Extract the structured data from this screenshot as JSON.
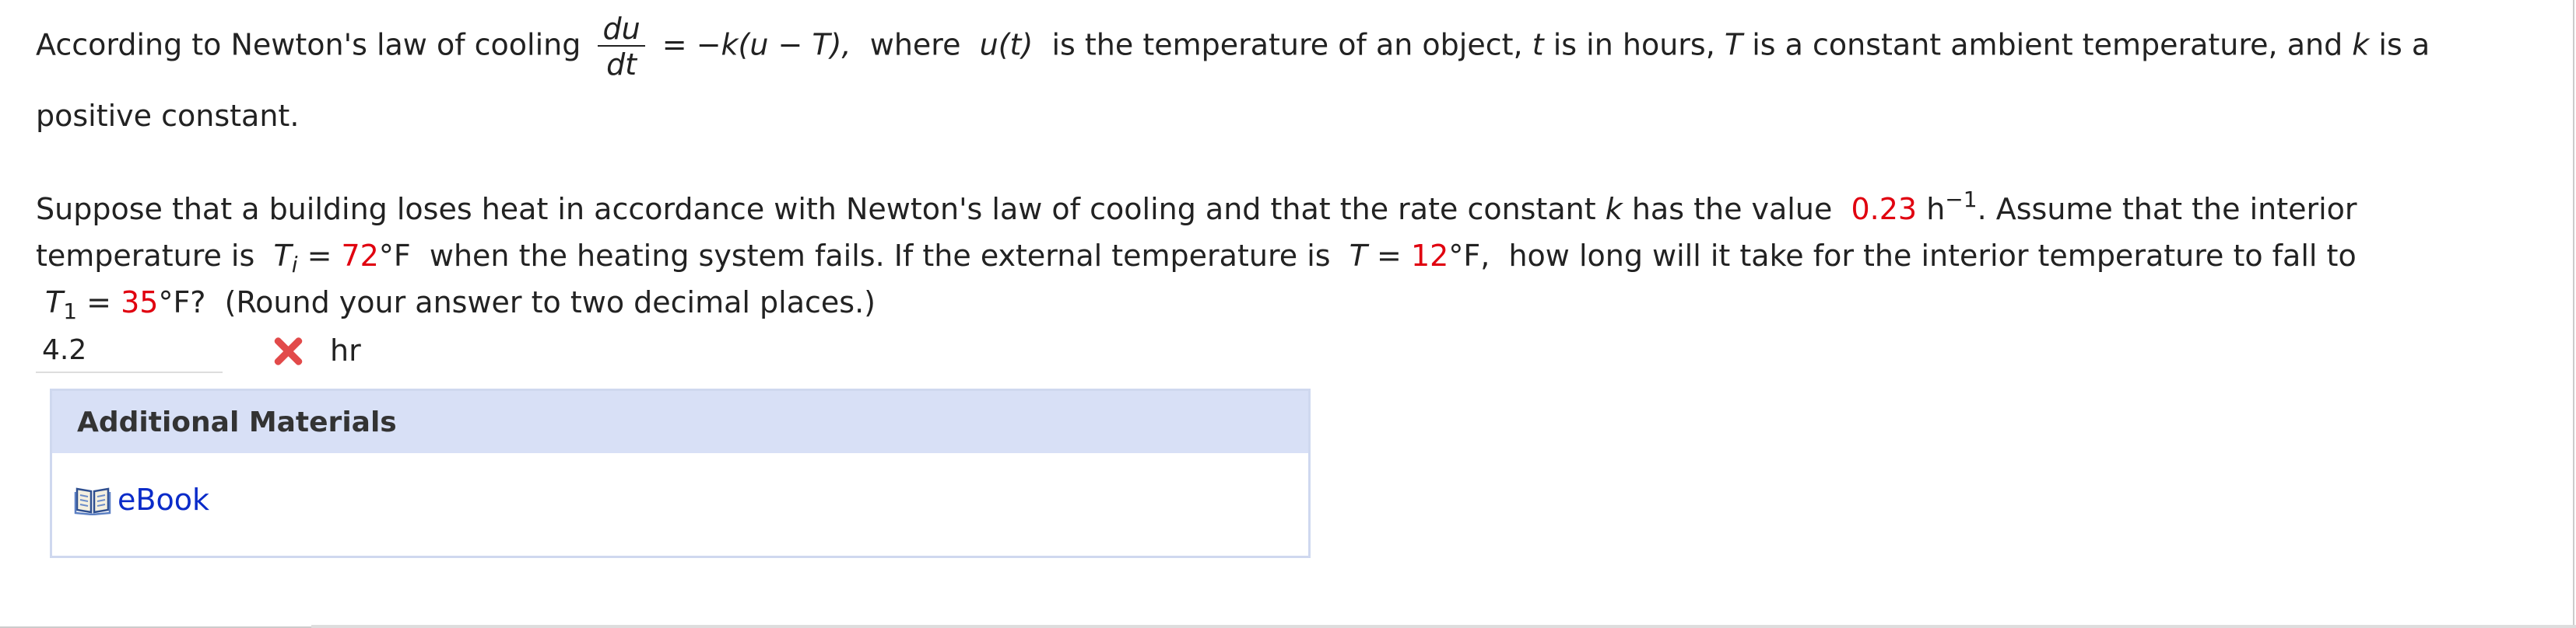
{
  "question": {
    "intro_prefix": "According to Newton's law of cooling",
    "fraction_num": "du",
    "fraction_den": "dt",
    "equation_rhs": "= −k(u − T),",
    "where_text": "where",
    "u_of_t": "u(t)",
    "intro_mid": "is the temperature of an object,",
    "t_var": "t",
    "hours_text": "is in hours,",
    "T_var": "T",
    "ambient_text": "is a constant ambient temperature, and",
    "k_var": "k",
    "intro_end": "is a",
    "intro_line2": "positive constant.",
    "p2_line1_start": "Suppose that a building loses heat in accordance with Newton's law of cooling and that the rate constant",
    "p2_k": "k",
    "p2_line1_mid": "has the value",
    "k_value": "0.23",
    "k_unit": "h",
    "k_unit_exp": "−1",
    "p2_line1_end": ". Assume that the interior",
    "p2_line2_start": "temperature is",
    "Ti_var": "T",
    "Ti_sub": "i",
    "eq_sign": "=",
    "Ti_value": "72",
    "deg_F": "°F",
    "p2_line2_mid": "when the heating system fails. If the external temperature is",
    "T_ext_var": "T",
    "T_ext_value": "12",
    "deg_F_comma": "°F,",
    "p2_line2_end": "how long will it take for the interior temperature to fall to",
    "T1_var": "T",
    "T1_sub": "1",
    "T1_value": "35",
    "deg_F_q": "°F?",
    "round_text": "(Round your answer to two decimal places.)"
  },
  "answer": {
    "value": "4.2",
    "status": "incorrect",
    "unit": "hr"
  },
  "materials": {
    "header": "Additional Materials",
    "link_label": "eBook"
  },
  "colors": {
    "highlight": "#e0000f",
    "link": "#0a2bc9",
    "panel_header": "#d8e0f6",
    "incorrect": "#e24a4a"
  },
  "icons": {
    "status": "x-mark-icon",
    "ebook": "open-book-icon"
  }
}
